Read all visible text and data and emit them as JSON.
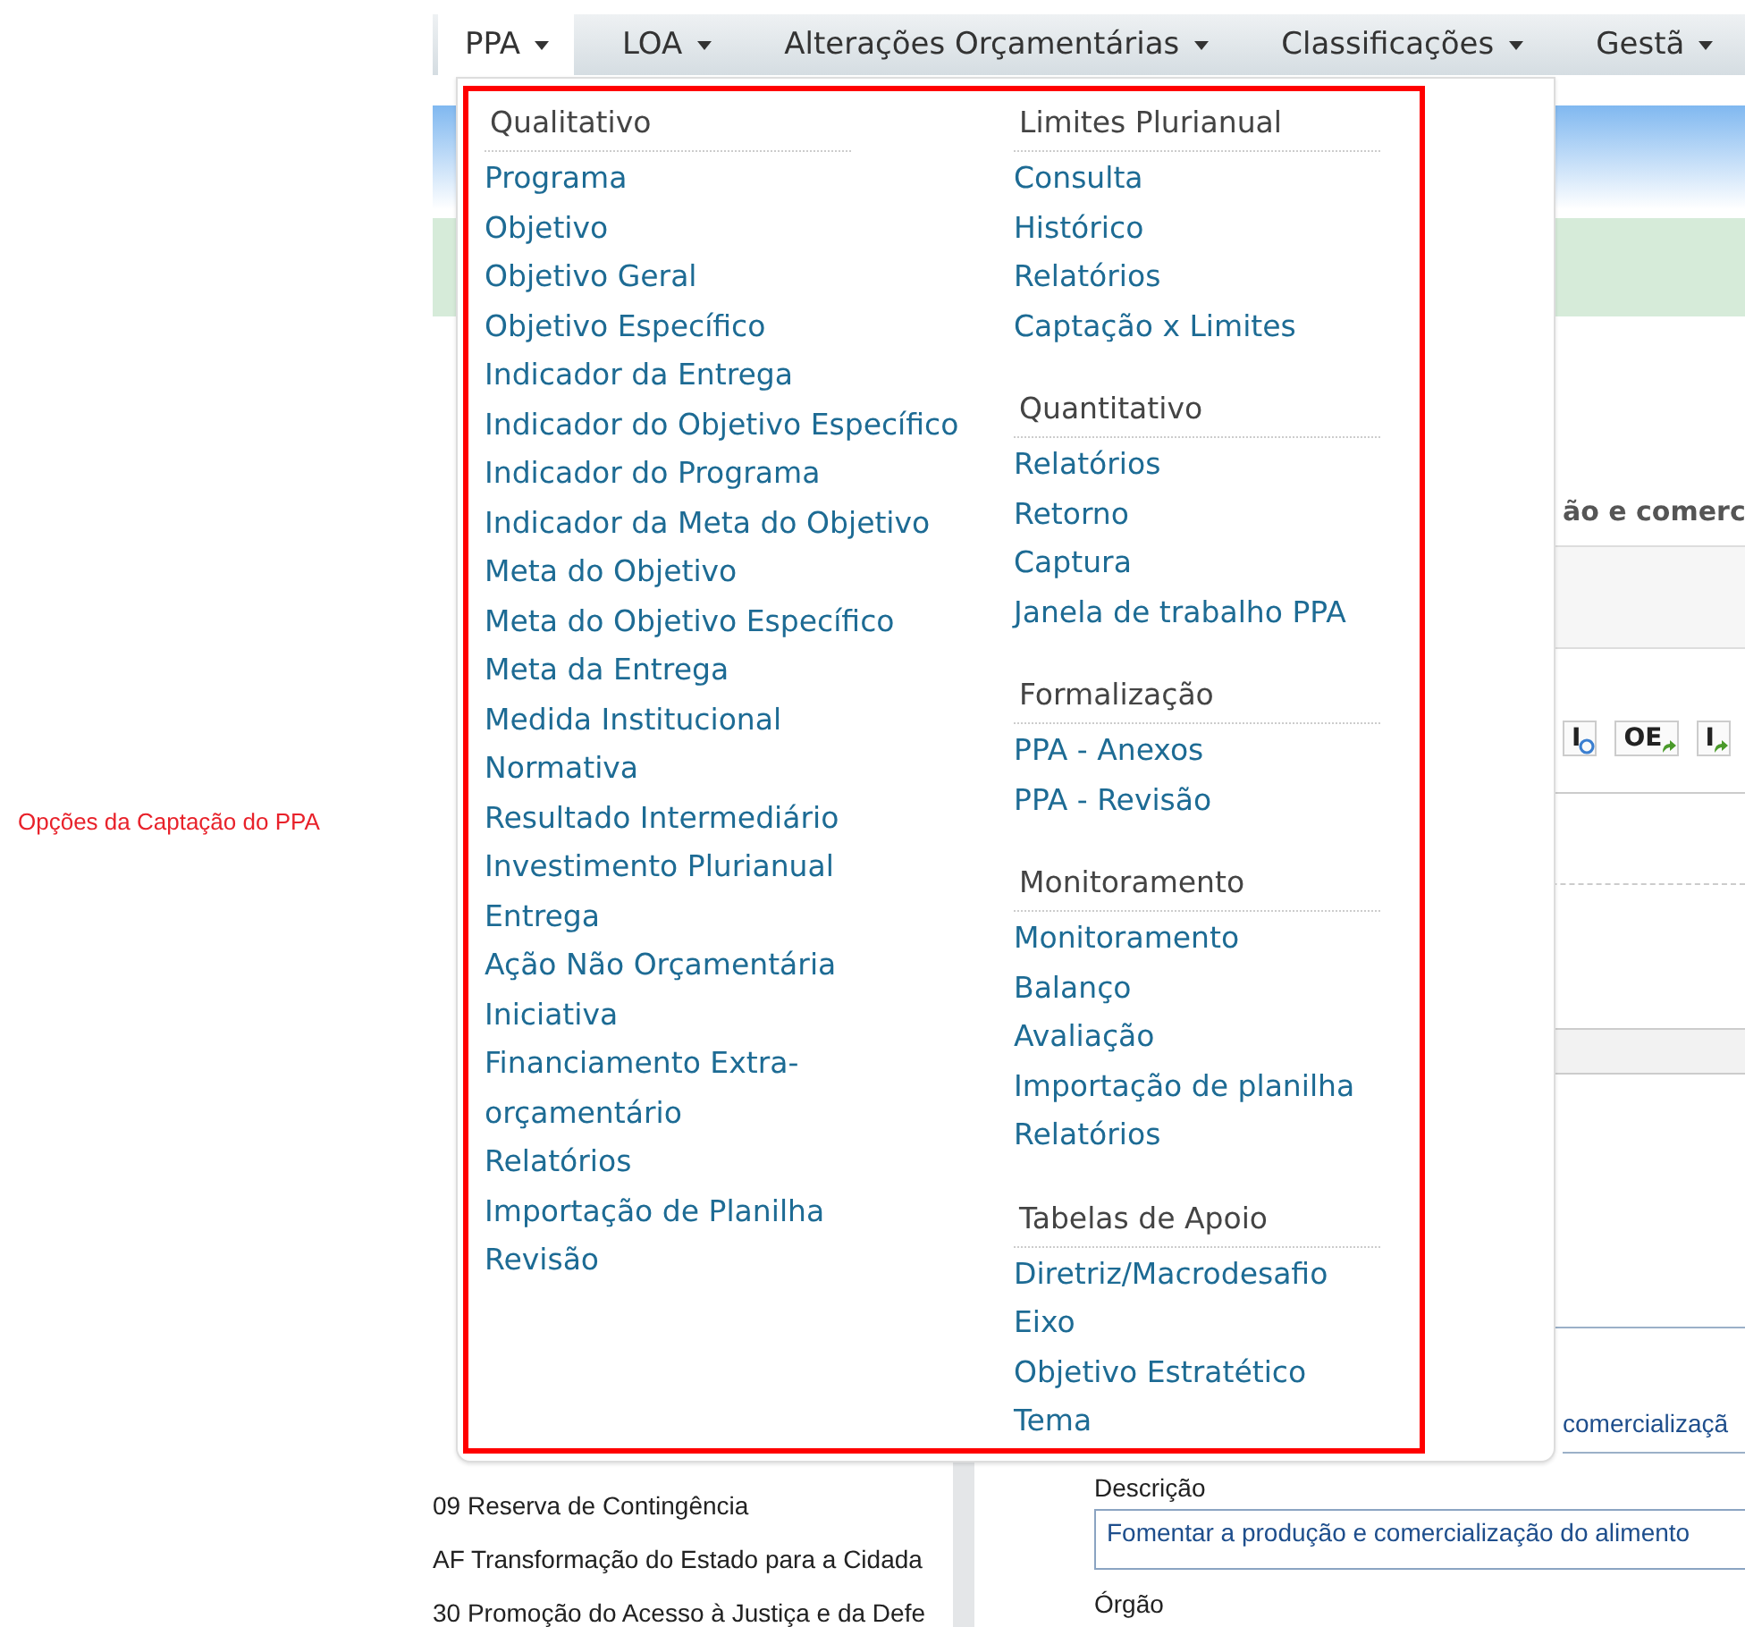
{
  "annotation": {
    "text": "Opções da Captação do PPA"
  },
  "nav": {
    "items": [
      {
        "label": "PPA",
        "selected": true
      },
      {
        "label": "LOA",
        "selected": false
      },
      {
        "label": "Alterações Orçamentárias",
        "selected": false
      },
      {
        "label": "Classificações",
        "selected": false
      },
      {
        "label": "Gestã",
        "selected": false
      }
    ]
  },
  "menu": {
    "columns": [
      [
        {
          "header": "Qualitativo",
          "items": [
            "Programa",
            "Objetivo",
            "Objetivo Geral",
            "Objetivo Específico",
            "Indicador da Entrega",
            "Indicador do Objetivo Específico",
            "Indicador do Programa",
            "Indicador da Meta do Objetivo",
            "Meta do Objetivo",
            "Meta do Objetivo Específico",
            "Meta da Entrega",
            "Medida Institucional",
            "Normativa",
            "Resultado Intermediário",
            "Investimento Plurianual",
            "Entrega",
            "Ação Não Orçamentária",
            "Iniciativa",
            "Financiamento Extra-orçamentário",
            "Relatórios",
            "Importação de Planilha",
            "Revisão"
          ]
        }
      ],
      [
        {
          "header": "Limites Plurianual",
          "items": [
            "Consulta",
            "Histórico",
            "Relatórios",
            "Captação x Limites"
          ]
        },
        {
          "header": "Quantitativo",
          "items": [
            "Relatórios",
            "Retorno",
            "Captura",
            "Janela de trabalho PPA"
          ]
        },
        {
          "header": "Formalização",
          "items": [
            "PPA - Anexos",
            "PPA - Revisão"
          ]
        },
        {
          "header": "Monitoramento",
          "items": [
            "Monitoramento",
            "Balanço",
            "Avaliação",
            "Importação de planilha",
            "Relatórios"
          ]
        },
        {
          "header": "Tabelas de Apoio",
          "items": [
            "Diretriz/Macrodesafio",
            "Eixo",
            "Objetivo Estratético",
            "Tema"
          ]
        }
      ]
    ]
  },
  "background": {
    "list_items": [
      "09 Reserva de Contingência",
      "AF Transformação do Estado para a Cidada",
      "30 Promoção do Acesso à Justiça e da Defe"
    ],
    "heading_fragment": "ão e comerc",
    "toolbar": [
      {
        "label": "I",
        "kind": "circle"
      },
      {
        "label": "OE",
        "kind": "arrow"
      },
      {
        "label": "I",
        "kind": "arrow"
      }
    ],
    "field_fragment": "comercializaçã",
    "description_label": "Descrição",
    "description_value": "Fomentar a produção e comercialização do alimento",
    "organ_label": "Órgão"
  }
}
